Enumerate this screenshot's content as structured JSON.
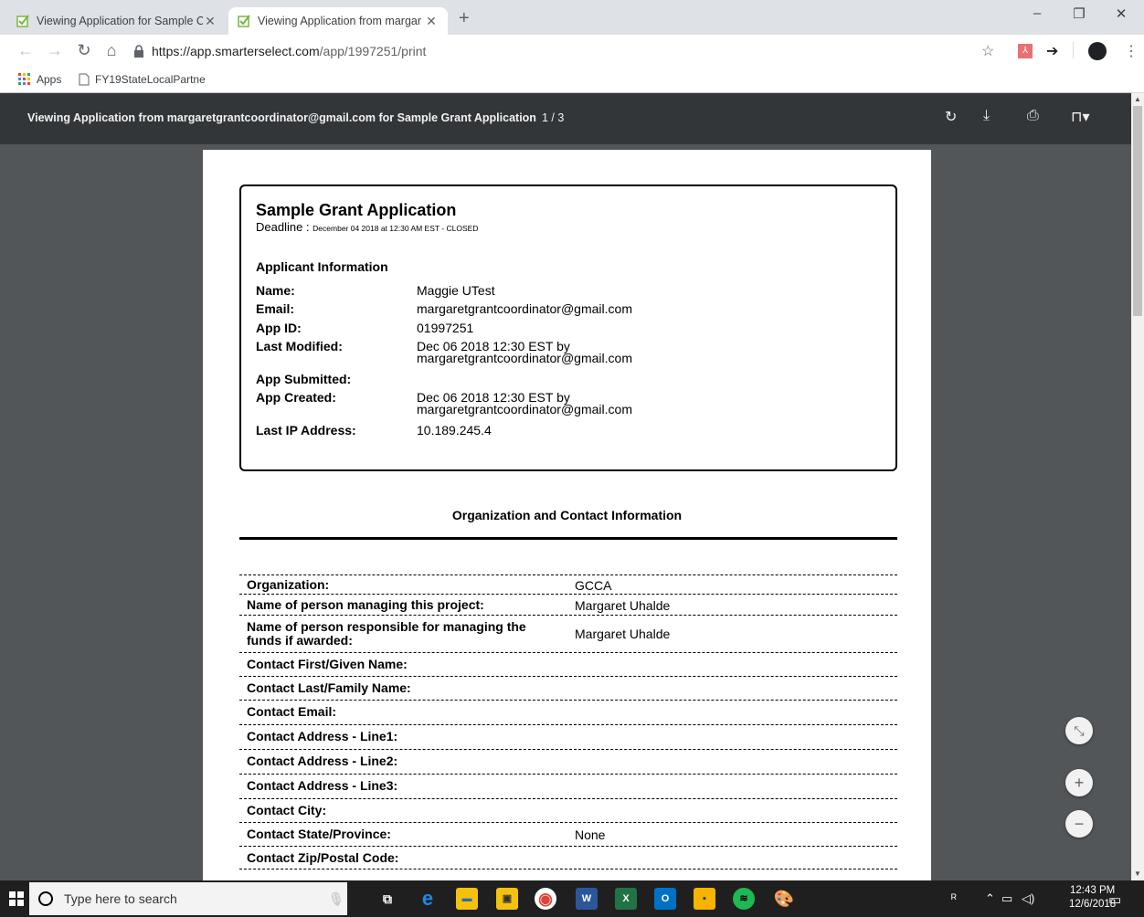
{
  "browser": {
    "tabs": [
      {
        "title": "Viewing Application for Sample C",
        "active": false
      },
      {
        "title": "Viewing Application from margar",
        "active": true
      }
    ],
    "new_tab": "+",
    "window_controls": {
      "minimize": "–",
      "maximize": "❐",
      "close": "✕"
    },
    "url_host": "https://app.smarterselect.com",
    "url_path": "/app/1997251/print",
    "bookmarks": [
      {
        "label": "Apps"
      },
      {
        "label": "FY19StateLocalPartne"
      }
    ]
  },
  "pdf": {
    "title": "Viewing Application from margaretgrantcoordinator@gmail.com for Sample Grant Application",
    "page_indicator": "1 / 3",
    "toolbar_icons": [
      "rotate-icon",
      "download-icon",
      "print-icon",
      "bookmark-icon"
    ]
  },
  "document": {
    "heading": "Sample Grant Application",
    "deadline_label": "Deadline :",
    "deadline_value": "December 04 2018 at 12:30 AM EST - CLOSED",
    "applicant_section": "Applicant Information",
    "applicant_rows": [
      {
        "label": "Name:",
        "value": "Maggie UTest"
      },
      {
        "label": "Email:",
        "value": "margaretgrantcoordinator@gmail.com"
      },
      {
        "label": "App ID:",
        "value": "01997251"
      },
      {
        "label": "Last Modified:",
        "value": "Dec 06 2018 12:30 EST by",
        "value2": "margaretgrantcoordinator@gmail.com"
      },
      {
        "label": "App Submitted:",
        "value": ""
      },
      {
        "label": "App Created:",
        "value": "Dec 06 2018 12:30 EST by",
        "value2": "margaretgrantcoordinator@gmail.com"
      },
      {
        "label": "Last IP Address:",
        "value": "10.189.245.4"
      }
    ],
    "org_section": "Organization and Contact Information",
    "org_rows": [
      {
        "label": "Organization:",
        "value": "GCCA"
      },
      {
        "label": "Name of person managing this project:",
        "value": "Margaret Uhalde"
      },
      {
        "label": "Name of person responsible for managing the funds if awarded:",
        "value": "Margaret Uhalde"
      },
      {
        "label": "Contact First/Given Name:",
        "value": ""
      },
      {
        "label": "Contact Last/Family Name:",
        "value": ""
      },
      {
        "label": "Contact Email:",
        "value": ""
      },
      {
        "label": "Contact Address - Line1:",
        "value": ""
      },
      {
        "label": "Contact Address - Line2:",
        "value": ""
      },
      {
        "label": "Contact Address - Line3:",
        "value": ""
      },
      {
        "label": "Contact City:",
        "value": ""
      },
      {
        "label": "Contact State/Province:",
        "value": "None"
      },
      {
        "label": "Contact Zip/Postal Code:",
        "value": ""
      }
    ]
  },
  "zoom_controls": {
    "fit": "⤡",
    "zoom_in": "+",
    "zoom_out": "−"
  },
  "taskbar": {
    "search_placeholder": "Type here to search",
    "time": "12:43 PM",
    "date": "12/6/2018"
  }
}
